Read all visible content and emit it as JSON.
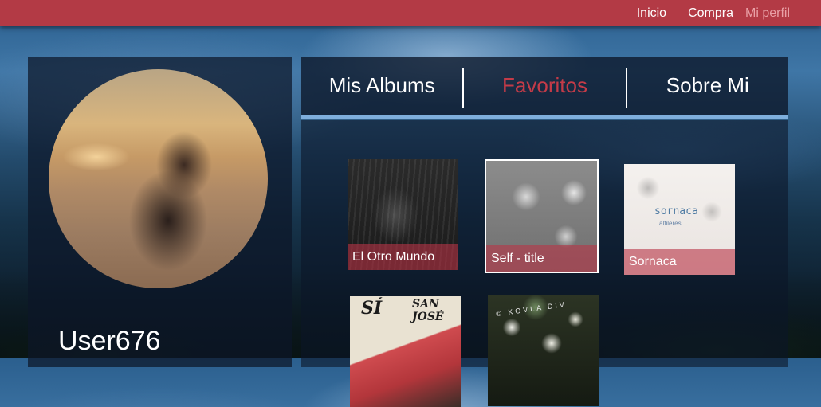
{
  "nav": {
    "items": [
      {
        "label": "Inicio"
      },
      {
        "label": "Compra"
      },
      {
        "label": "Mi perfil"
      }
    ]
  },
  "profile": {
    "username": "User676"
  },
  "tabs": [
    {
      "label": "Mis Albums",
      "active": false
    },
    {
      "label": "Favoritos",
      "active": true
    },
    {
      "label": "Sobre Mi",
      "active": false
    }
  ],
  "albums": [
    {
      "title": "El Otro Mundo"
    },
    {
      "title": "Self - title",
      "selected": true
    },
    {
      "title": "Sornaca",
      "cover_text": "sornaca",
      "cover_subtext": "alfileres"
    },
    {
      "title": "",
      "cover_text_1": "SÍ",
      "cover_text_2": "SAN JOSÉ"
    },
    {
      "title": "",
      "cover_text": "© KOVLA DIV"
    }
  ],
  "colors": {
    "topbar": "#b33a45",
    "active_tab": "#c43b48",
    "tab_underline": "#7eaedc"
  }
}
